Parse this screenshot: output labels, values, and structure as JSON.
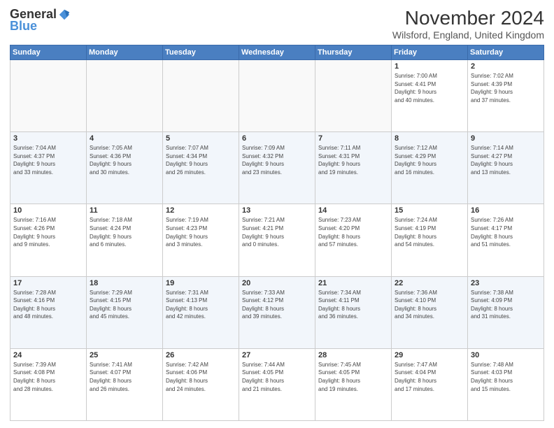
{
  "header": {
    "logo": {
      "general": "General",
      "blue": "Blue"
    },
    "title": "November 2024",
    "location": "Wilsford, England, United Kingdom"
  },
  "weekdays": [
    "Sunday",
    "Monday",
    "Tuesday",
    "Wednesday",
    "Thursday",
    "Friday",
    "Saturday"
  ],
  "weeks": [
    {
      "days": [
        {
          "num": "",
          "info": ""
        },
        {
          "num": "",
          "info": ""
        },
        {
          "num": "",
          "info": ""
        },
        {
          "num": "",
          "info": ""
        },
        {
          "num": "",
          "info": ""
        },
        {
          "num": "1",
          "info": "Sunrise: 7:00 AM\nSunset: 4:41 PM\nDaylight: 9 hours\nand 40 minutes."
        },
        {
          "num": "2",
          "info": "Sunrise: 7:02 AM\nSunset: 4:39 PM\nDaylight: 9 hours\nand 37 minutes."
        }
      ]
    },
    {
      "days": [
        {
          "num": "3",
          "info": "Sunrise: 7:04 AM\nSunset: 4:37 PM\nDaylight: 9 hours\nand 33 minutes."
        },
        {
          "num": "4",
          "info": "Sunrise: 7:05 AM\nSunset: 4:36 PM\nDaylight: 9 hours\nand 30 minutes."
        },
        {
          "num": "5",
          "info": "Sunrise: 7:07 AM\nSunset: 4:34 PM\nDaylight: 9 hours\nand 26 minutes."
        },
        {
          "num": "6",
          "info": "Sunrise: 7:09 AM\nSunset: 4:32 PM\nDaylight: 9 hours\nand 23 minutes."
        },
        {
          "num": "7",
          "info": "Sunrise: 7:11 AM\nSunset: 4:31 PM\nDaylight: 9 hours\nand 19 minutes."
        },
        {
          "num": "8",
          "info": "Sunrise: 7:12 AM\nSunset: 4:29 PM\nDaylight: 9 hours\nand 16 minutes."
        },
        {
          "num": "9",
          "info": "Sunrise: 7:14 AM\nSunset: 4:27 PM\nDaylight: 9 hours\nand 13 minutes."
        }
      ]
    },
    {
      "days": [
        {
          "num": "10",
          "info": "Sunrise: 7:16 AM\nSunset: 4:26 PM\nDaylight: 9 hours\nand 9 minutes."
        },
        {
          "num": "11",
          "info": "Sunrise: 7:18 AM\nSunset: 4:24 PM\nDaylight: 9 hours\nand 6 minutes."
        },
        {
          "num": "12",
          "info": "Sunrise: 7:19 AM\nSunset: 4:23 PM\nDaylight: 9 hours\nand 3 minutes."
        },
        {
          "num": "13",
          "info": "Sunrise: 7:21 AM\nSunset: 4:21 PM\nDaylight: 9 hours\nand 0 minutes."
        },
        {
          "num": "14",
          "info": "Sunrise: 7:23 AM\nSunset: 4:20 PM\nDaylight: 8 hours\nand 57 minutes."
        },
        {
          "num": "15",
          "info": "Sunrise: 7:24 AM\nSunset: 4:19 PM\nDaylight: 8 hours\nand 54 minutes."
        },
        {
          "num": "16",
          "info": "Sunrise: 7:26 AM\nSunset: 4:17 PM\nDaylight: 8 hours\nand 51 minutes."
        }
      ]
    },
    {
      "days": [
        {
          "num": "17",
          "info": "Sunrise: 7:28 AM\nSunset: 4:16 PM\nDaylight: 8 hours\nand 48 minutes."
        },
        {
          "num": "18",
          "info": "Sunrise: 7:29 AM\nSunset: 4:15 PM\nDaylight: 8 hours\nand 45 minutes."
        },
        {
          "num": "19",
          "info": "Sunrise: 7:31 AM\nSunset: 4:13 PM\nDaylight: 8 hours\nand 42 minutes."
        },
        {
          "num": "20",
          "info": "Sunrise: 7:33 AM\nSunset: 4:12 PM\nDaylight: 8 hours\nand 39 minutes."
        },
        {
          "num": "21",
          "info": "Sunrise: 7:34 AM\nSunset: 4:11 PM\nDaylight: 8 hours\nand 36 minutes."
        },
        {
          "num": "22",
          "info": "Sunrise: 7:36 AM\nSunset: 4:10 PM\nDaylight: 8 hours\nand 34 minutes."
        },
        {
          "num": "23",
          "info": "Sunrise: 7:38 AM\nSunset: 4:09 PM\nDaylight: 8 hours\nand 31 minutes."
        }
      ]
    },
    {
      "days": [
        {
          "num": "24",
          "info": "Sunrise: 7:39 AM\nSunset: 4:08 PM\nDaylight: 8 hours\nand 28 minutes."
        },
        {
          "num": "25",
          "info": "Sunrise: 7:41 AM\nSunset: 4:07 PM\nDaylight: 8 hours\nand 26 minutes."
        },
        {
          "num": "26",
          "info": "Sunrise: 7:42 AM\nSunset: 4:06 PM\nDaylight: 8 hours\nand 24 minutes."
        },
        {
          "num": "27",
          "info": "Sunrise: 7:44 AM\nSunset: 4:05 PM\nDaylight: 8 hours\nand 21 minutes."
        },
        {
          "num": "28",
          "info": "Sunrise: 7:45 AM\nSunset: 4:05 PM\nDaylight: 8 hours\nand 19 minutes."
        },
        {
          "num": "29",
          "info": "Sunrise: 7:47 AM\nSunset: 4:04 PM\nDaylight: 8 hours\nand 17 minutes."
        },
        {
          "num": "30",
          "info": "Sunrise: 7:48 AM\nSunset: 4:03 PM\nDaylight: 8 hours\nand 15 minutes."
        }
      ]
    }
  ]
}
